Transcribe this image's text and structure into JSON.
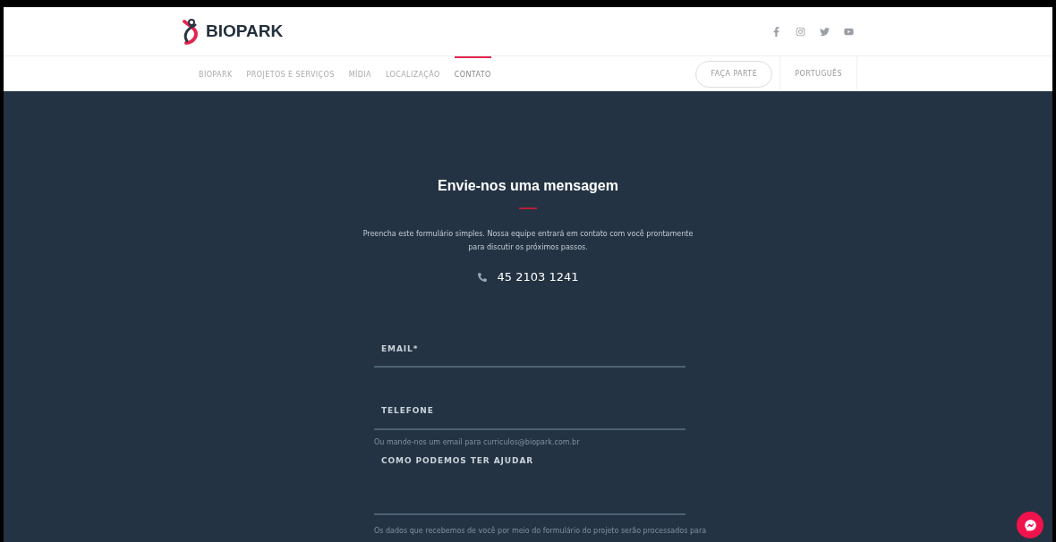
{
  "header": {
    "logo": "BIOPARK",
    "social": [
      {
        "kind": "facebook"
      },
      {
        "kind": "instagram"
      },
      {
        "kind": "twitter"
      },
      {
        "kind": "youtube"
      }
    ]
  },
  "nav": {
    "items": [
      {
        "label": "BIOPARK",
        "selected": false
      },
      {
        "label": "PROJETOS E SERVIÇOS",
        "selected": false
      },
      {
        "label": "MÍDIA",
        "selected": false
      },
      {
        "label": "LOCALIZAÇÃO",
        "selected": false
      },
      {
        "label": "CONTATO",
        "selected": true
      }
    ],
    "cta": "FAÇA PARTE",
    "language": "PORTUGUÊS"
  },
  "contact": {
    "title": "Envie-nos uma mensagem",
    "intro": "Preencha este formulário simples. Nossa equipe entrará em contato com você prontamente para discutir os próximos passos.",
    "phone": "45 2103 1241"
  },
  "form": {
    "fields": [
      {
        "kind": "input",
        "label": "EMAIL*"
      },
      {
        "kind": "input",
        "label": "TELEFONE"
      },
      {
        "kind": "note",
        "text": "Ou mande-nos um email para curriculos@biopark.com.br"
      },
      {
        "kind": "textarea",
        "label": "COMO PODEMOS TER AJUDAR"
      },
      {
        "kind": "note",
        "text": "Os dados que recebemos de você por meio do formulário do projeto serão processados para"
      }
    ]
  }
}
